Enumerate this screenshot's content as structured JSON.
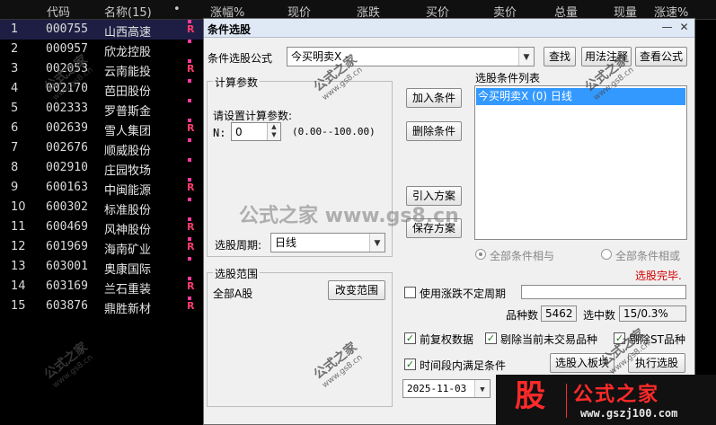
{
  "table": {
    "headers": [
      "代码",
      "名称(15)",
      "•",
      "涨幅%",
      "现价",
      "涨跌",
      "买价",
      "卖价",
      "总量",
      "现量",
      "涨速%"
    ],
    "rows": [
      {
        "idx": "1",
        "code": "000755",
        "name": "山西高速",
        "flag": "R"
      },
      {
        "idx": "2",
        "code": "000957",
        "name": "欣龙控股",
        "flag": ""
      },
      {
        "idx": "3",
        "code": "002053",
        "name": "云南能投",
        "flag": "R"
      },
      {
        "idx": "4",
        "code": "002170",
        "name": "芭田股份",
        "flag": ""
      },
      {
        "idx": "5",
        "code": "002333",
        "name": "罗普斯金",
        "flag": ""
      },
      {
        "idx": "6",
        "code": "002639",
        "name": "雪人集团",
        "flag": "R"
      },
      {
        "idx": "7",
        "code": "002676",
        "name": "顺威股份",
        "flag": ""
      },
      {
        "idx": "8",
        "code": "002910",
        "name": "庄园牧场",
        "flag": ""
      },
      {
        "idx": "9",
        "code": "600163",
        "name": "中闽能源",
        "flag": "R"
      },
      {
        "idx": "10",
        "code": "600302",
        "name": "标准股份",
        "flag": ""
      },
      {
        "idx": "11",
        "code": "600469",
        "name": "风神股份",
        "flag": "R"
      },
      {
        "idx": "12",
        "code": "601969",
        "name": "海南矿业",
        "flag": "R"
      },
      {
        "idx": "13",
        "code": "603001",
        "name": "奥康国际",
        "flag": ""
      },
      {
        "idx": "14",
        "code": "603169",
        "name": "兰石重装",
        "flag": "R"
      },
      {
        "idx": "15",
        "code": "603876",
        "name": "鼎胜新材",
        "flag": "R"
      }
    ]
  },
  "dialog": {
    "title": "条件选股",
    "close": "✕",
    "minimize": "—",
    "formula_label": "条件选股公式",
    "formula_value": "今买明卖X - ",
    "find_btn": "查找",
    "usage_btn": "用法注释",
    "view_btn": "查看公式",
    "calc_group": "计算参数",
    "set_params_label": "请设置计算参数:",
    "n_label": "N:",
    "n_value": "0",
    "n_range": "(0.00--100.00)",
    "period_label": "选股周期:",
    "period_value": "日线",
    "add_cond_btn": "加入条件",
    "del_cond_btn": "删除条件",
    "import_btn": "引入方案",
    "save_btn": "保存方案",
    "cond_list_label": "选股条件列表",
    "cond_items": [
      "今买明卖X (0) 日线"
    ],
    "radio_and": "全部条件相与",
    "radio_or": "全部条件相或",
    "status": "选股完毕.",
    "range_group": "选股范围",
    "range_value": "全部A股",
    "change_range_btn": "改变范围",
    "use_period_label": "使用涨跌不定周期",
    "count_label": "品种数",
    "count_value": "5462",
    "selected_label": "选中数",
    "selected_value": "15/0.3%",
    "pre_adj_label": "前复权数据",
    "remove_untraded_label": "剔除当前未交易品种",
    "remove_st_label": "剔除ST品种",
    "time_range_label": "时间段内满足条件",
    "date_value": "2025-11-03",
    "to_board_btn": "选股入板块",
    "run_btn": "执行选股"
  },
  "watermarks": {
    "main": "公式之家 www.gs8.cn",
    "stamp_text": "公式之家",
    "stamp_url": "www.gs8.cn"
  },
  "logo": {
    "glyph": "股",
    "brand": "公式之家",
    "url": "www.gszj100.com"
  },
  "colors": {
    "flag_red": "#ff3b6b",
    "status_red": "#d40000",
    "selected_blue": "#3399ff",
    "logo_red": "#ff2a2a"
  }
}
